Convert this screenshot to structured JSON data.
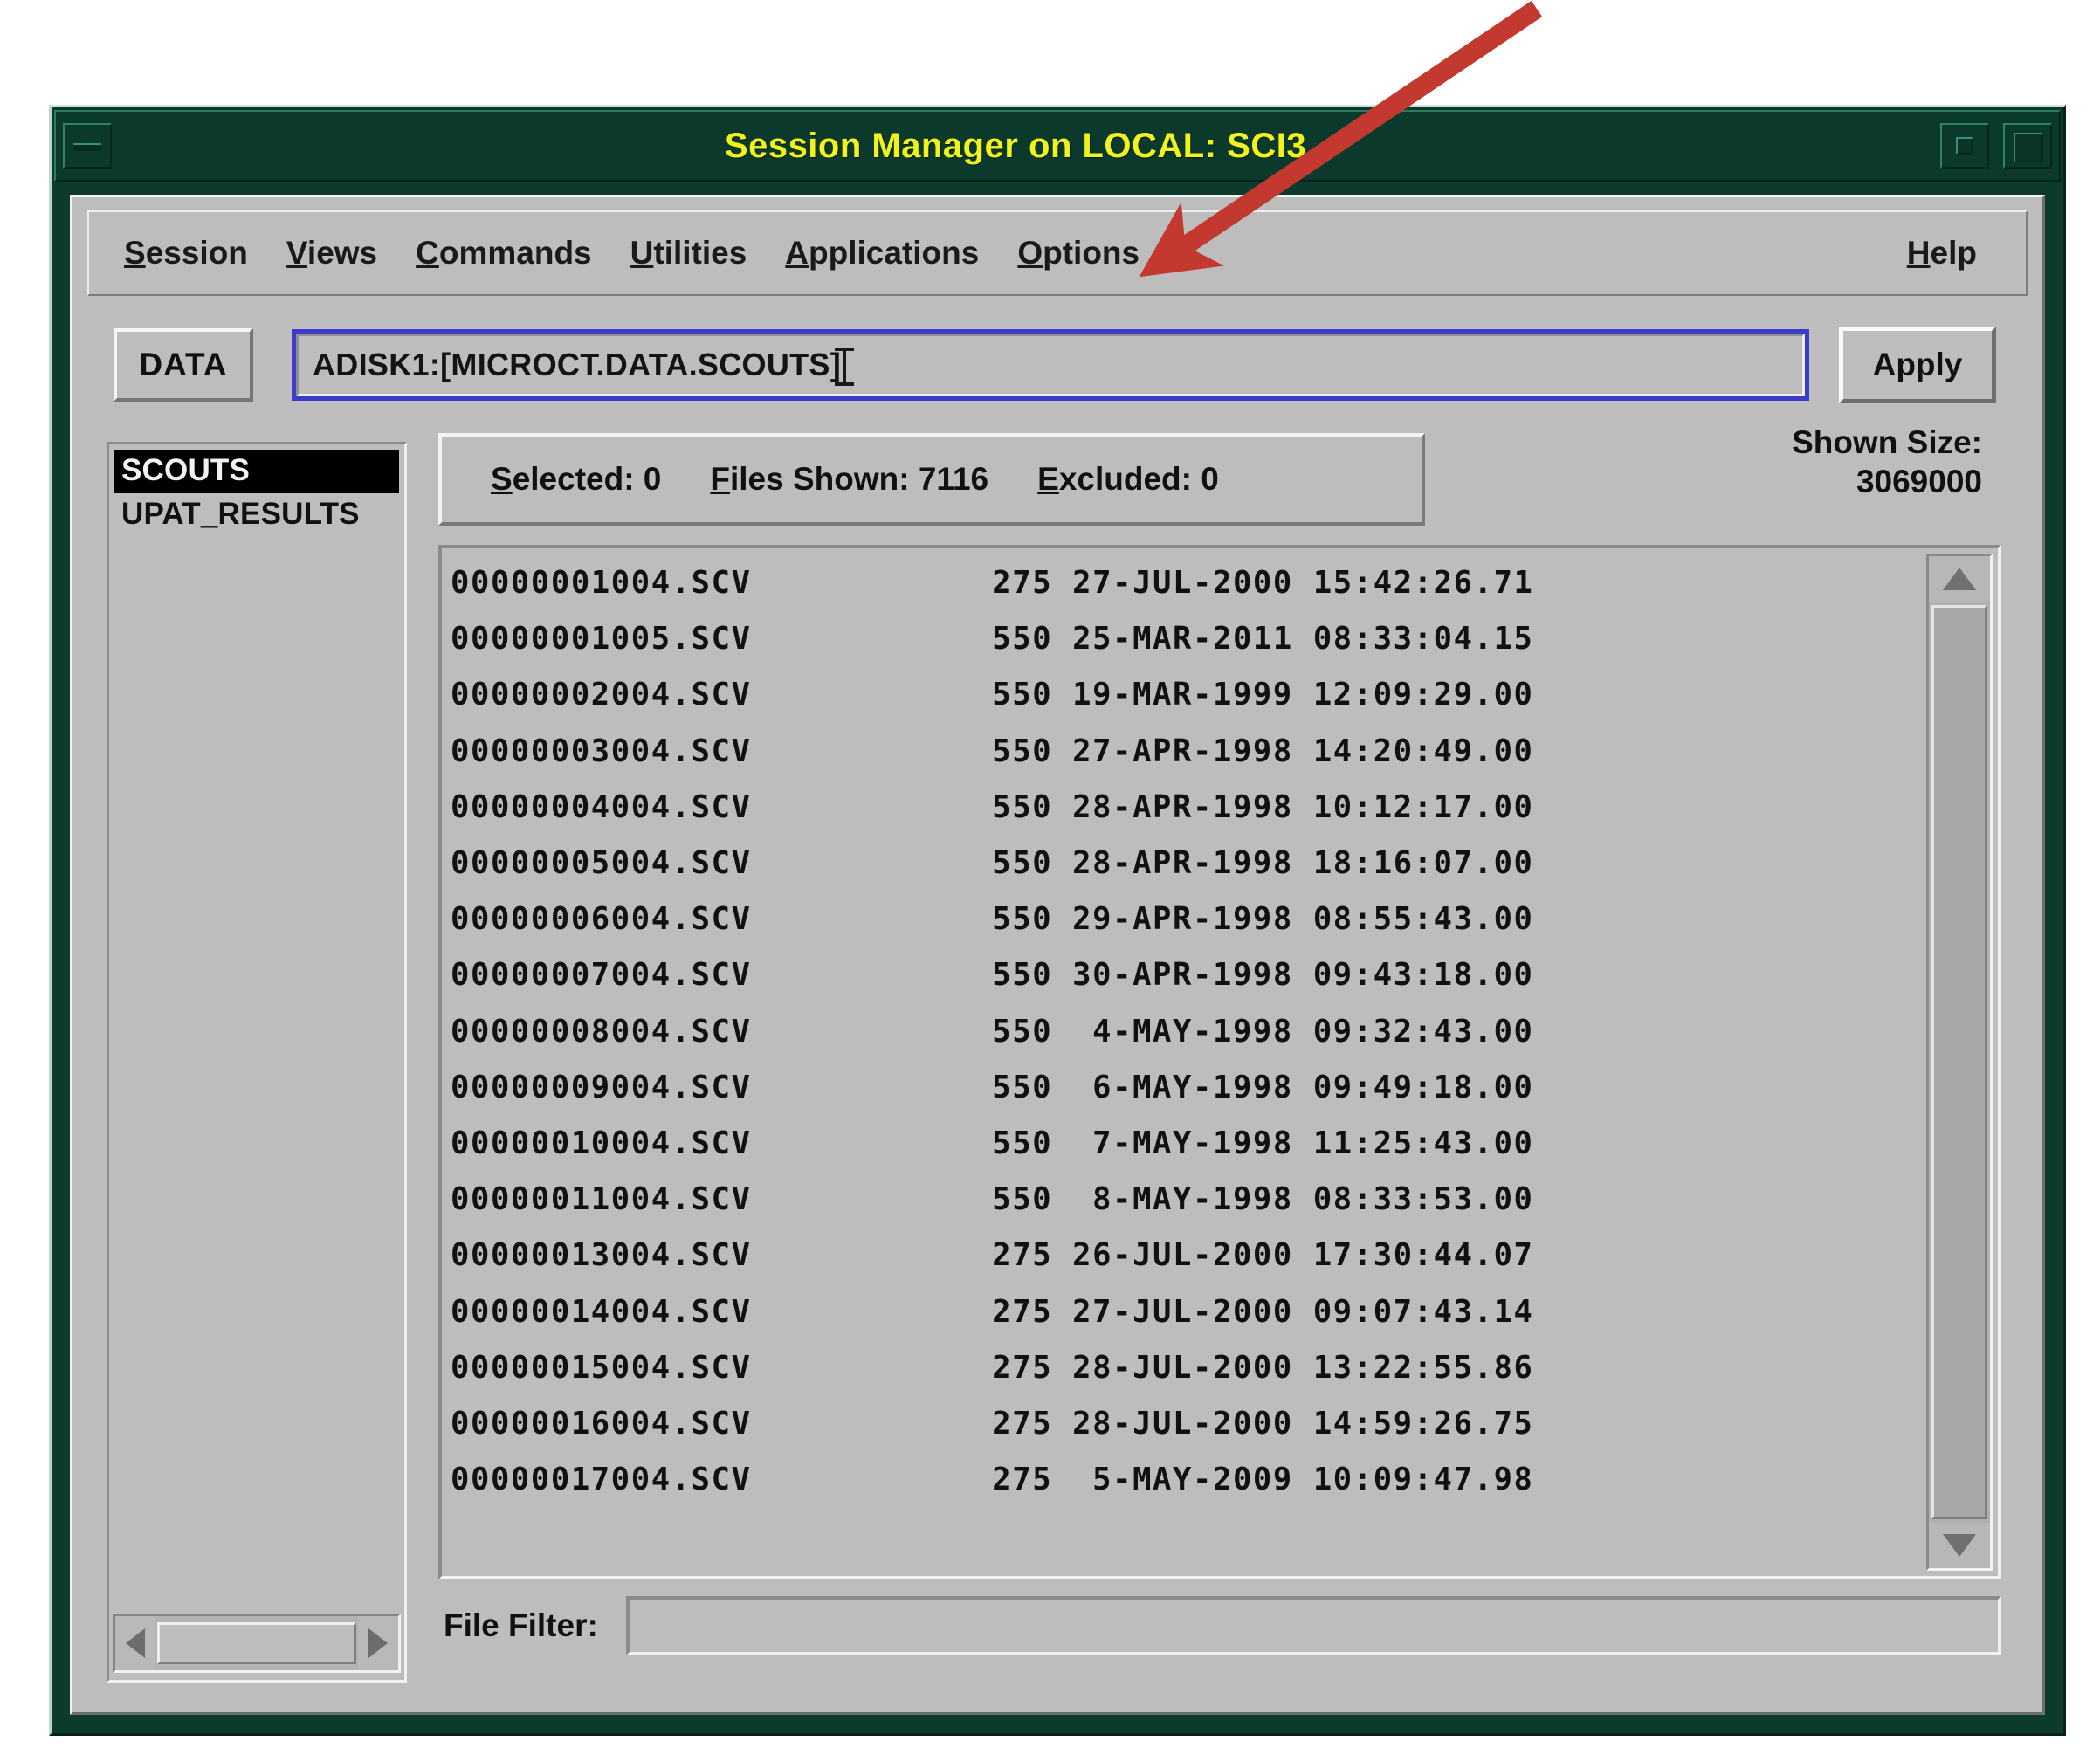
{
  "window": {
    "title": "Session Manager on LOCAL: SCI3",
    "title_color": "#f2f21c",
    "frame_color": "#0b3a2d",
    "face_color": "#bdbdbd",
    "minimize_label": "",
    "restore_label": "",
    "maximize_label": ""
  },
  "menu": {
    "items": [
      {
        "mnemonic": "S",
        "rest": "ession"
      },
      {
        "mnemonic": "V",
        "rest": "iews"
      },
      {
        "mnemonic": "C",
        "rest": "ommands"
      },
      {
        "mnemonic": "U",
        "rest": "tilities"
      },
      {
        "mnemonic": "A",
        "rest": "pplications"
      },
      {
        "mnemonic": "O",
        "rest": "ptions"
      }
    ],
    "help": {
      "mnemonic": "H",
      "rest": "elp"
    }
  },
  "path_row": {
    "data_button_label": "DATA",
    "path_value": "ADISK1:[MICROCT.DATA.SCOUTS]",
    "path_placeholder": "",
    "apply_button_label": "Apply",
    "focus_border_color": "#3b3bcc"
  },
  "directories": {
    "items": [
      {
        "label": "SCOUTS",
        "selected": true
      },
      {
        "label": "UPAT_RESULTS",
        "selected": false
      }
    ]
  },
  "counts": {
    "selected": {
      "mnemonic": "S",
      "rest": "elected: 0"
    },
    "files_shown": {
      "mnemonic": "F",
      "rest": "iles Shown: 7116"
    },
    "excluded": {
      "mnemonic": "E",
      "rest": "xcluded: 0"
    }
  },
  "shown_size": {
    "label": "Shown Size:",
    "value": "3069000"
  },
  "file_list": {
    "columns": [
      "name",
      "size",
      "date",
      "time"
    ],
    "rows": [
      {
        "name": "00000001004.SCV",
        "size": "275",
        "date": "27-JUL-2000",
        "time": "15:42:26.71"
      },
      {
        "name": "00000001005.SCV",
        "size": "550",
        "date": "25-MAR-2011",
        "time": "08:33:04.15"
      },
      {
        "name": "00000002004.SCV",
        "size": "550",
        "date": "19-MAR-1999",
        "time": "12:09:29.00"
      },
      {
        "name": "00000003004.SCV",
        "size": "550",
        "date": "27-APR-1998",
        "time": "14:20:49.00"
      },
      {
        "name": "00000004004.SCV",
        "size": "550",
        "date": "28-APR-1998",
        "time": "10:12:17.00"
      },
      {
        "name": "00000005004.SCV",
        "size": "550",
        "date": "28-APR-1998",
        "time": "18:16:07.00"
      },
      {
        "name": "00000006004.SCV",
        "size": "550",
        "date": "29-APR-1998",
        "time": "08:55:43.00"
      },
      {
        "name": "00000007004.SCV",
        "size": "550",
        "date": "30-APR-1998",
        "time": "09:43:18.00"
      },
      {
        "name": "00000008004.SCV",
        "size": "550",
        "date": " 4-MAY-1998",
        "time": "09:32:43.00"
      },
      {
        "name": "00000009004.SCV",
        "size": "550",
        "date": " 6-MAY-1998",
        "time": "09:49:18.00"
      },
      {
        "name": "00000010004.SCV",
        "size": "550",
        "date": " 7-MAY-1998",
        "time": "11:25:43.00"
      },
      {
        "name": "00000011004.SCV",
        "size": "550",
        "date": " 8-MAY-1998",
        "time": "08:33:53.00"
      },
      {
        "name": "00000013004.SCV",
        "size": "275",
        "date": "26-JUL-2000",
        "time": "17:30:44.07"
      },
      {
        "name": "00000014004.SCV",
        "size": "275",
        "date": "27-JUL-2000",
        "time": "09:07:43.14"
      },
      {
        "name": "00000015004.SCV",
        "size": "275",
        "date": "28-JUL-2000",
        "time": "13:22:55.86"
      },
      {
        "name": "00000016004.SCV",
        "size": "275",
        "date": "28-JUL-2000",
        "time": "14:59:26.75"
      },
      {
        "name": "00000017004.SCV",
        "size": "275",
        "date": " 5-MAY-2009",
        "time": "10:09:47.98"
      }
    ]
  },
  "file_filter": {
    "label": "File Filter:",
    "value": "",
    "placeholder": ""
  },
  "annotation": {
    "arrow_color": "#c3392f",
    "points_at": "Applications"
  }
}
